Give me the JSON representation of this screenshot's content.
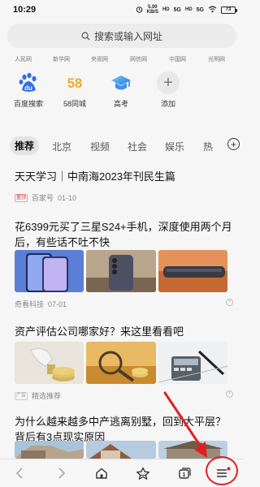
{
  "status_bar": {
    "time": "10:29",
    "speed_top": "5.00",
    "speed_bottom": "KB/S",
    "hd1": "HD",
    "net1": "5G",
    "hd2": "HD",
    "net2": "5G",
    "battery": "73"
  },
  "search": {
    "placeholder": "搜索或输入网址"
  },
  "sites": [
    "人民网",
    "新华网",
    "央视网",
    "网信网",
    "中国网",
    "光明网"
  ],
  "quick_links": [
    {
      "label": "百度搜索",
      "icon": "du"
    },
    {
      "label": "58同城",
      "icon": "58"
    },
    {
      "label": "高考",
      "icon": "graduation-cap-icon"
    },
    {
      "label": "添加",
      "icon": "+"
    }
  ],
  "tabs": [
    "推荐",
    "北京",
    "视频",
    "社会",
    "娱乐",
    "热"
  ],
  "news": [
    {
      "title": "天天学习｜中南海2023年刊民生篇",
      "badge": "置顶",
      "source": "百家号",
      "date": "01-10"
    },
    {
      "title": "花6399元买了三星S24+手机，深度使用两个月后，有些话不吐不快",
      "source": "奇看科技",
      "date": "07-01"
    },
    {
      "title": "资产评估公司哪家好？来这里看看吧",
      "badge": "广告",
      "source": "精选推荐"
    },
    {
      "title": "为什么越来越多中产逃离别墅，回到大平层？背后有3点现实原因"
    }
  ],
  "colors": {
    "accent_red": "#e02020",
    "baidu_blue": "#2f6ee6",
    "58_orange": "#f5a623",
    "58_blue": "#2a8cf0"
  }
}
